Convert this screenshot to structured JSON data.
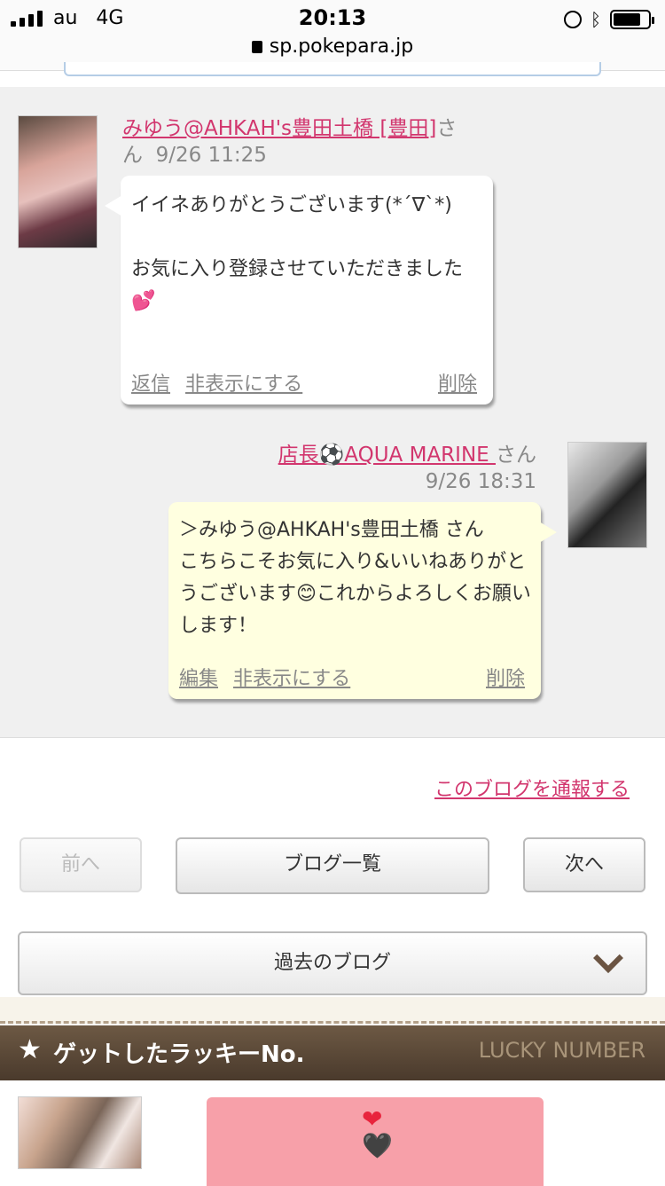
{
  "status_bar": {
    "carrier": "au",
    "network": "4G",
    "time": "20:13",
    "url": "sp.pokepara.jp"
  },
  "comments": [
    {
      "name": "みゆう@AHKAH's豊田土橋 [豊田]",
      "suffix": "さん",
      "date": "9/26 11:25",
      "text": "イイネありがとうございます(*´∇`*)\n\nお気に入り登録させていただきました💕",
      "actions": [
        "返信",
        "非表示にする",
        "削除"
      ]
    },
    {
      "name": "店長⚽AQUA MARINE ",
      "suffix": "さん",
      "date": "9/26 18:31",
      "text": "＞みゆう@AHKAH's豊田土橋 さん\nこちらこそお気に入り&いいねありがとうございます😊これからよろしくお願いします！",
      "actions": [
        "編集",
        "非表示にする",
        "削除"
      ]
    }
  ],
  "report_link": "このブログを通報する",
  "nav": {
    "prev": "前へ",
    "list": "ブログ一覧",
    "next": "次へ"
  },
  "past_blog": "過去のブログ",
  "lucky": {
    "title": "ゲットしたラッキーNo.",
    "subtitle": "LUCKY NUMBER"
  },
  "icons": {
    "star": "★",
    "heart_red": "❤",
    "heart_black": "🖤"
  }
}
